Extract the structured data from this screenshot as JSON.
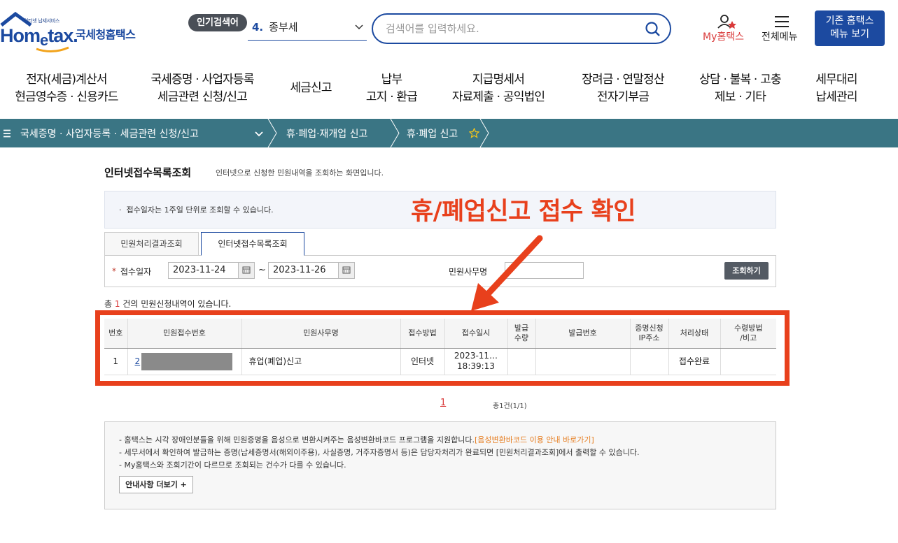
{
  "header": {
    "logo_small": "인터넷 납세서비스",
    "logo_main_prefix": "Hom",
    "logo_main_e": "e",
    "logo_main_suffix": "tax.",
    "logo_sub": "국세청홈택스",
    "popular_badge": "인기검색어",
    "popular_num": "4.",
    "popular_value": "종부세",
    "search_placeholder": "검색어를 입력하세요.",
    "my_hometax": "My홈택스",
    "all_menu": "전체메뉴",
    "old_hometax_line1": "기존 홈택스",
    "old_hometax_line2": "메뉴 보기"
  },
  "gnb": [
    {
      "line1": "전자(세금)계산서",
      "line2": "현금영수증 · 신용카드"
    },
    {
      "line1": "국세증명 · 사업자등록",
      "line2": "세금관련 신청/신고"
    },
    {
      "line1": "세금신고",
      "line2": ""
    },
    {
      "line1": "납부",
      "line2": "고지 · 환급"
    },
    {
      "line1": "지급명세서",
      "line2": "자료제출 · 공익법인"
    },
    {
      "line1": "장려금 · 연말정산",
      "line2": "전자기부금"
    },
    {
      "line1": "상담 · 불복 · 고충",
      "line2": "제보 · 기타"
    },
    {
      "line1": "세무대리",
      "line2": "납세관리"
    }
  ],
  "breadcrumb": {
    "level1": "국세증명 · 사업자등록 · 세금관련 신청/신고",
    "level2": "휴·폐업·재개업 신고",
    "level3": "휴·폐업 신고"
  },
  "page": {
    "title": "인터넷접수목록조회",
    "desc": "인터넷으로 신청한 민원내역을 조회하는 화면입니다.",
    "notice": "접수일자는 1주일 단위로 조회할 수 있습니다.",
    "annotation": "휴/폐업신고 접수 확인"
  },
  "tabs": [
    {
      "label": "민원처리결과조회"
    },
    {
      "label": "인터넷접수목록조회"
    }
  ],
  "filter": {
    "required_mark": "*",
    "date_label": "접수일자",
    "date_from": "2023-11-24",
    "tilde": "~",
    "date_to": "2023-11-26",
    "minwon_label": "민원사무명",
    "search_button": "조회하기"
  },
  "count": {
    "prefix": "총",
    "number": "1",
    "suffix": "건의 민원신청내역이 있습니다."
  },
  "table": {
    "headers": [
      "번호",
      "민원접수번호",
      "민원사무명",
      "접수방법",
      "접수일시",
      "발급\n수량",
      "발급번호",
      "증명신청\nIP주소",
      "처리상태",
      "수령방법\n/비고"
    ],
    "rows": [
      {
        "no": "1",
        "receipt_no": "2",
        "name": "휴업(폐업)신고",
        "method": "인터넷",
        "datetime_line1": "2023-11…",
        "datetime_line2": "18:39:13",
        "qty": "",
        "issue_no": "",
        "ip": "",
        "status": "접수완료",
        "remark": ""
      }
    ]
  },
  "pager": {
    "current": "1",
    "total": "총1건(1/1)"
  },
  "guide": {
    "line1": "- 홈택스는 시각 장애인분들을 위해 민원증명을 음성으로 변환시켜주는 음성변환바코드 프로그램을 지원합니다.",
    "line1_link": "[음성변환바코드 이용 안내 바로가기]",
    "line2": "- 세무서에서 확인하여 발급하는 증명(납세증명서(해외이주용), 사실증명, 거주자증명서 등)은 담당자처리가 완료되면 [민원처리결과조회]에서 출력할 수 있습니다.",
    "line3": "- My홈택스와 조회기간이 다르므로 조회되는 건수가 다를 수 있습니다.",
    "more_button": "안내사항 더보기 +"
  },
  "colors": {
    "brand": "#1c4aa0",
    "crumb_bar": "#3a7584",
    "annotation": "#e8401c"
  }
}
